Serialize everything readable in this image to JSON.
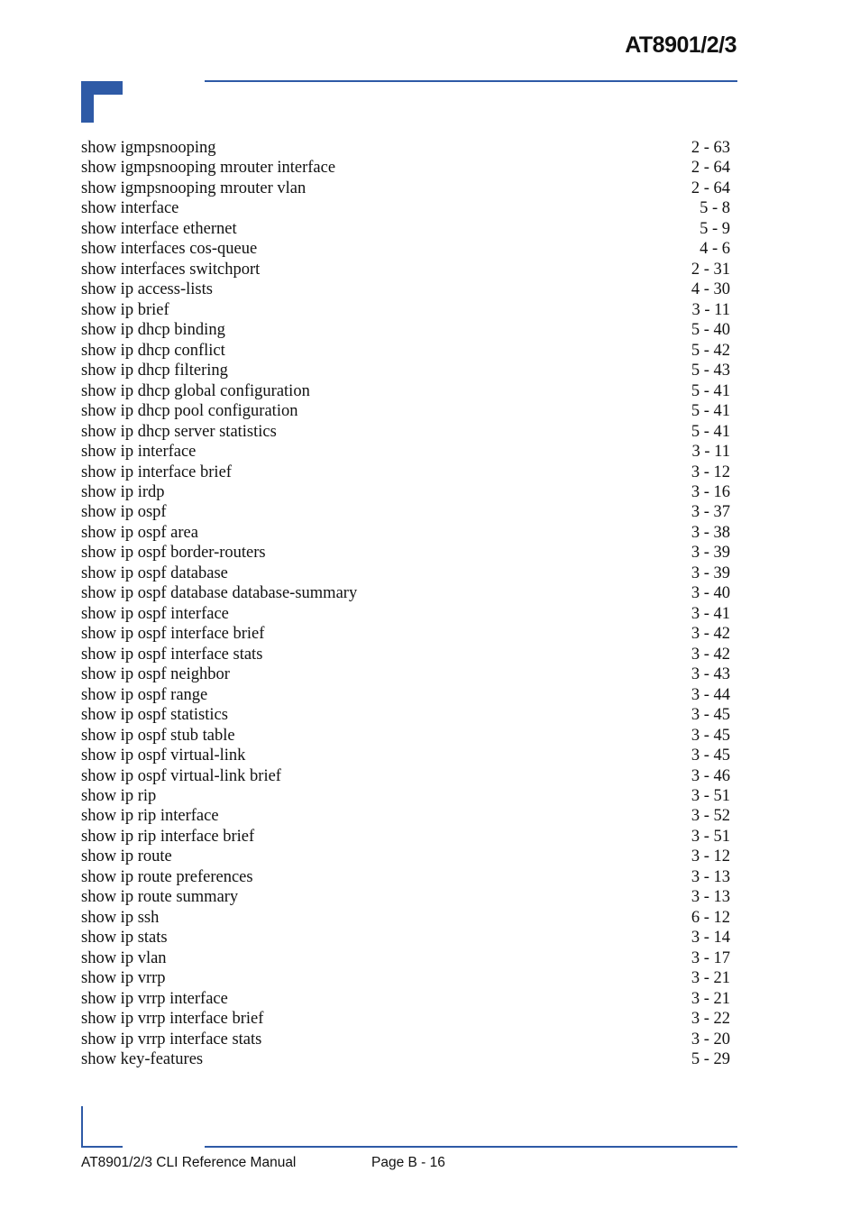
{
  "header": {
    "title": "AT8901/2/3"
  },
  "entries": [
    {
      "command": "show igmpsnooping",
      "page": "2 - 63"
    },
    {
      "command": "show igmpsnooping mrouter interface",
      "page": "2 - 64"
    },
    {
      "command": "show igmpsnooping mrouter vlan",
      "page": "2 - 64"
    },
    {
      "command": "show interface",
      "page": "5 - 8"
    },
    {
      "command": "show interface ethernet",
      "page": "5 - 9"
    },
    {
      "command": "show interfaces cos-queue",
      "page": "4 - 6"
    },
    {
      "command": "show interfaces switchport",
      "page": "2 - 31"
    },
    {
      "command": "show ip access-lists",
      "page": "4 - 30"
    },
    {
      "command": "show ip brief",
      "page": "3 - 11"
    },
    {
      "command": "show ip dhcp binding",
      "page": "5 - 40"
    },
    {
      "command": "show ip dhcp conflict",
      "page": "5 - 42"
    },
    {
      "command": "show ip dhcp filtering",
      "page": "5 - 43"
    },
    {
      "command": "show ip dhcp global configuration",
      "page": "5 - 41"
    },
    {
      "command": "show ip dhcp pool configuration",
      "page": "5 - 41"
    },
    {
      "command": "show ip dhcp server statistics",
      "page": "5 - 41"
    },
    {
      "command": "show ip interface",
      "page": "3 - 11"
    },
    {
      "command": "show ip interface brief",
      "page": "3 - 12"
    },
    {
      "command": "show ip irdp",
      "page": "3 - 16"
    },
    {
      "command": "show ip ospf",
      "page": "3 - 37"
    },
    {
      "command": "show ip ospf area",
      "page": "3 - 38"
    },
    {
      "command": "show ip ospf border-routers",
      "page": "3 - 39"
    },
    {
      "command": "show ip ospf database",
      "page": "3 - 39"
    },
    {
      "command": "show ip ospf database database-summary",
      "page": "3 - 40"
    },
    {
      "command": "show ip ospf interface",
      "page": "3 - 41"
    },
    {
      "command": "show ip ospf interface brief",
      "page": "3 - 42"
    },
    {
      "command": "show ip ospf interface stats",
      "page": "3 - 42"
    },
    {
      "command": "show ip ospf neighbor",
      "page": "3 - 43"
    },
    {
      "command": "show ip ospf range",
      "page": "3 - 44"
    },
    {
      "command": "show ip ospf statistics",
      "page": "3 - 45"
    },
    {
      "command": "show ip ospf stub table",
      "page": "3 - 45"
    },
    {
      "command": "show ip ospf virtual-link",
      "page": "3 - 45"
    },
    {
      "command": "show ip ospf virtual-link brief",
      "page": "3 - 46"
    },
    {
      "command": "show ip rip",
      "page": "3 - 51"
    },
    {
      "command": "show ip rip interface",
      "page": "3 - 52"
    },
    {
      "command": "show ip rip interface brief",
      "page": "3 - 51"
    },
    {
      "command": "show ip route",
      "page": "3 - 12"
    },
    {
      "command": "show ip route preferences",
      "page": "3 - 13"
    },
    {
      "command": "show ip route summary",
      "page": "3 - 13"
    },
    {
      "command": "show ip ssh",
      "page": "6 - 12"
    },
    {
      "command": "show ip stats",
      "page": "3 - 14"
    },
    {
      "command": "show ip vlan",
      "page": "3 - 17"
    },
    {
      "command": "show ip vrrp",
      "page": "3 - 21"
    },
    {
      "command": "show ip vrrp interface",
      "page": "3 - 21"
    },
    {
      "command": "show ip vrrp interface brief",
      "page": "3 - 22"
    },
    {
      "command": "show ip vrrp interface stats",
      "page": "3 - 20"
    },
    {
      "command": "show key-features",
      "page": "5 - 29"
    }
  ],
  "footer": {
    "manual_title": "AT8901/2/3 CLI Reference Manual",
    "page_label": "Page B - 16"
  },
  "colors": {
    "accent": "#2e5aa6"
  }
}
